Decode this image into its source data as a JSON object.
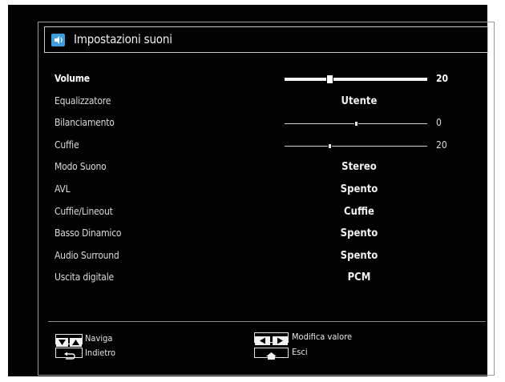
{
  "header": {
    "title": "Impostazioni suoni",
    "icon": "sound-settings-icon",
    "accent": "#3a9ee0"
  },
  "settings": [
    {
      "label": "Volume",
      "type": "slider",
      "value": 20,
      "range": [
        0,
        63
      ],
      "active": true
    },
    {
      "label": "Equalizzatore",
      "type": "option",
      "value": "Utente"
    },
    {
      "label": "Bilanciamento",
      "type": "slider",
      "value": 0,
      "range": [
        -50,
        50
      ]
    },
    {
      "label": "Cuffie",
      "type": "slider",
      "value": 20,
      "range": [
        0,
        63
      ]
    },
    {
      "label": "Modo Suono",
      "type": "option",
      "value": "Stereo"
    },
    {
      "label": "AVL",
      "type": "option",
      "value": "Spento"
    },
    {
      "label": "Cuffie/Lineout",
      "type": "option",
      "value": "Cuffie"
    },
    {
      "label": "Basso Dinamico",
      "type": "option",
      "value": "Spento"
    },
    {
      "label": "Audio Surround",
      "type": "option",
      "value": "Spento"
    },
    {
      "label": "Uscita digitale",
      "type": "option",
      "value": "PCM"
    }
  ],
  "legend": {
    "navigate": "Naviga",
    "back": "Indietro",
    "change_value": "Modifica valore",
    "exit": "Esci"
  }
}
